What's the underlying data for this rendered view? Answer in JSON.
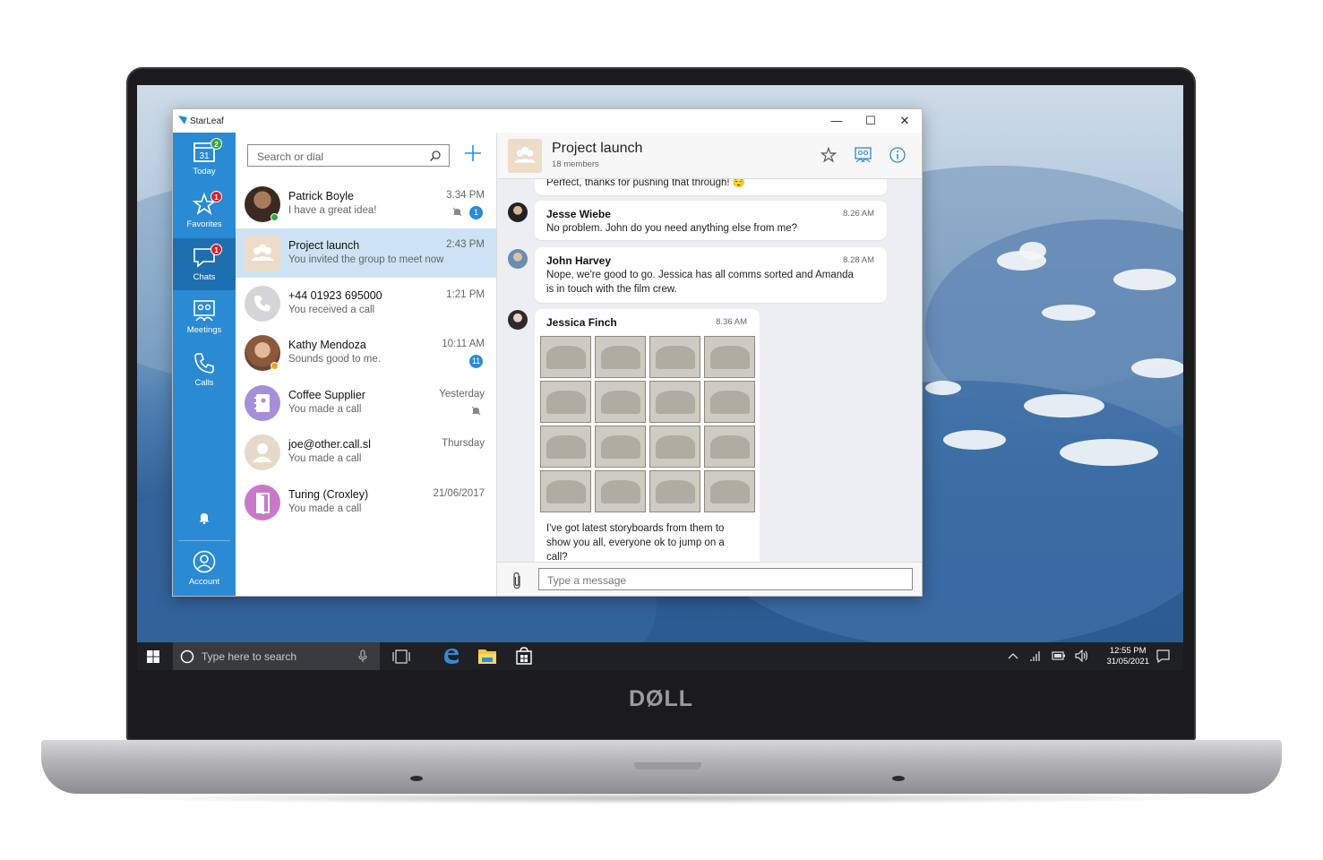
{
  "device": {
    "brand": "DØLL"
  },
  "app": {
    "window_title": "StarLeaf",
    "window_controls": {
      "minimize": "—",
      "maximize": "☐",
      "close": "✕"
    }
  },
  "nav": {
    "items": [
      {
        "label": "Today",
        "icon": "calendar-icon",
        "date": "31",
        "badge": "2"
      },
      {
        "label": "Favorites",
        "icon": "star-icon",
        "badge": "1"
      },
      {
        "label": "Chats",
        "icon": "chat-bubble-icon",
        "badge": "1"
      },
      {
        "label": "Meetings",
        "icon": "meetings-icon"
      },
      {
        "label": "Calls",
        "icon": "phone-icon"
      }
    ],
    "notifications_icon": "bell-icon",
    "account": {
      "label": "Account",
      "icon": "account-icon"
    }
  },
  "list": {
    "search_placeholder": "Search or dial",
    "add_icon": "plus-icon",
    "conversations": [
      {
        "name": "Patrick Boyle",
        "subtitle": "I have a great idea!",
        "time": "3.34 PM",
        "badge": "1",
        "muted": true,
        "status": "online"
      },
      {
        "name": "Project launch",
        "subtitle": "You invited the group to meet now",
        "time": "2:43 PM",
        "active": true
      },
      {
        "name": "+44 01923 695000",
        "subtitle": "You received a call",
        "time": "1:21 PM"
      },
      {
        "name": "Kathy Mendoza",
        "subtitle": "Sounds good to me.",
        "time": "10:11 AM",
        "badge": "11",
        "status": "away"
      },
      {
        "name": "Coffee Supplier",
        "subtitle": "You made a call",
        "time": "Yesterday",
        "muted": true
      },
      {
        "name": "joe@other.call.sl",
        "subtitle": "You made a call",
        "time": "Thursday"
      },
      {
        "name": "Turing (Croxley)",
        "subtitle": "You made a call",
        "time": "21/06/2017"
      }
    ]
  },
  "chat": {
    "title": "Project launch",
    "members": "18 members",
    "messages": [
      {
        "text": "Perfect, thanks for pushing that through! 😌"
      },
      {
        "author": "Jesse Wiebe",
        "time": "8.26 AM",
        "text": "No problem. John do you need anything else from me?"
      },
      {
        "author": "John Harvey",
        "time": "8.28 AM",
        "text_line1": "Nope, we're good to go. Jessica has all comms sorted and Amanda",
        "text_line2": "is in touch with the film crew."
      },
      {
        "author": "Jessica Finch",
        "time": "8.36 AM",
        "text_line1": "I've got latest storyboards from them to",
        "text_line2": "show you all, everyone ok to jump on a",
        "text_line3": "call?"
      }
    ],
    "composer_placeholder": "Type a message"
  },
  "taskbar": {
    "search_placeholder": "Type here to search",
    "time": "12:55 PM",
    "date": "31/05/2021"
  }
}
